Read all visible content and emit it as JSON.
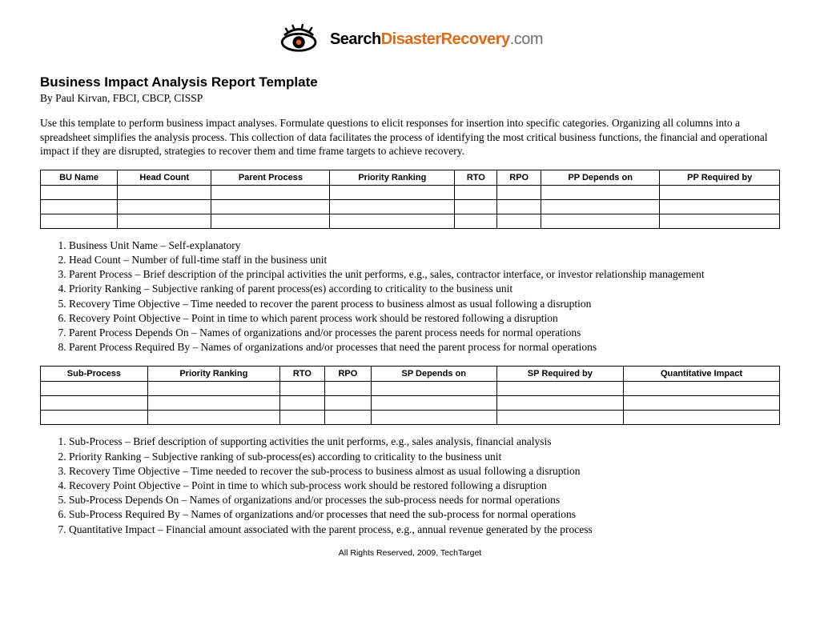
{
  "logo": {
    "part1": "Search",
    "part2": "DisasterRecovery",
    "part3": ".com"
  },
  "title": "Business Impact Analysis Report Template",
  "byline": "By Paul Kirvan, FBCI, CBCP, CISSP",
  "intro": "Use this template to perform business impact analyses. Formulate questions to elicit responses for insertion into specific categories. Organizing all columns into a spreadsheet simplifies the analysis process. This collection of data facilitates the process of identifying the most critical business functions, the financial and operational impact if they are disrupted, strategies to recover them and time frame targets to achieve recovery.",
  "table1_headers": [
    "BU Name",
    "Head Count",
    "Parent Process",
    "Priority Ranking",
    "RTO",
    "RPO",
    "PP Depends on",
    "PP Required by"
  ],
  "list1": [
    "Business Unit Name – Self-explanatory",
    "Head Count – Number of full-time staff in the business unit",
    "Parent Process – Brief description of the principal activities the unit performs, e.g., sales, contractor interface, or investor relationship management",
    "Priority Ranking – Subjective ranking of parent process(es) according to criticality to the business unit",
    "Recovery Time Objective – Time needed to recover the parent process to business almost as usual following a disruption",
    "Recovery Point Objective – Point in time to which parent process work should be restored following a disruption",
    "Parent Process Depends On – Names of organizations and/or processes the parent process needs for normal operations",
    "Parent Process Required By – Names of organizations and/or processes that need the parent process for normal operations"
  ],
  "table2_headers": [
    "Sub-Process",
    "Priority Ranking",
    "RTO",
    "RPO",
    "SP Depends on",
    "SP Required by",
    "Quantitative Impact"
  ],
  "list2": [
    "Sub-Process – Brief description of supporting activities the unit performs, e.g., sales analysis, financial analysis",
    "Priority Ranking – Subjective ranking of sub-process(es) according to criticality to the business unit",
    "Recovery Time Objective – Time needed to recover the sub-process to business almost as usual following a disruption",
    "Recovery Point Objective – Point in time to which sub-process work should be restored following a disruption",
    "Sub-Process Depends On – Names of organizations and/or processes the sub-process needs for normal operations",
    "Sub-Process Required By – Names of organizations and/or processes that need the sub-process for normal operations",
    "Quantitative Impact – Financial amount associated with the parent process, e.g., annual revenue generated by the process"
  ],
  "footer": "All Rights Reserved, 2009, TechTarget"
}
